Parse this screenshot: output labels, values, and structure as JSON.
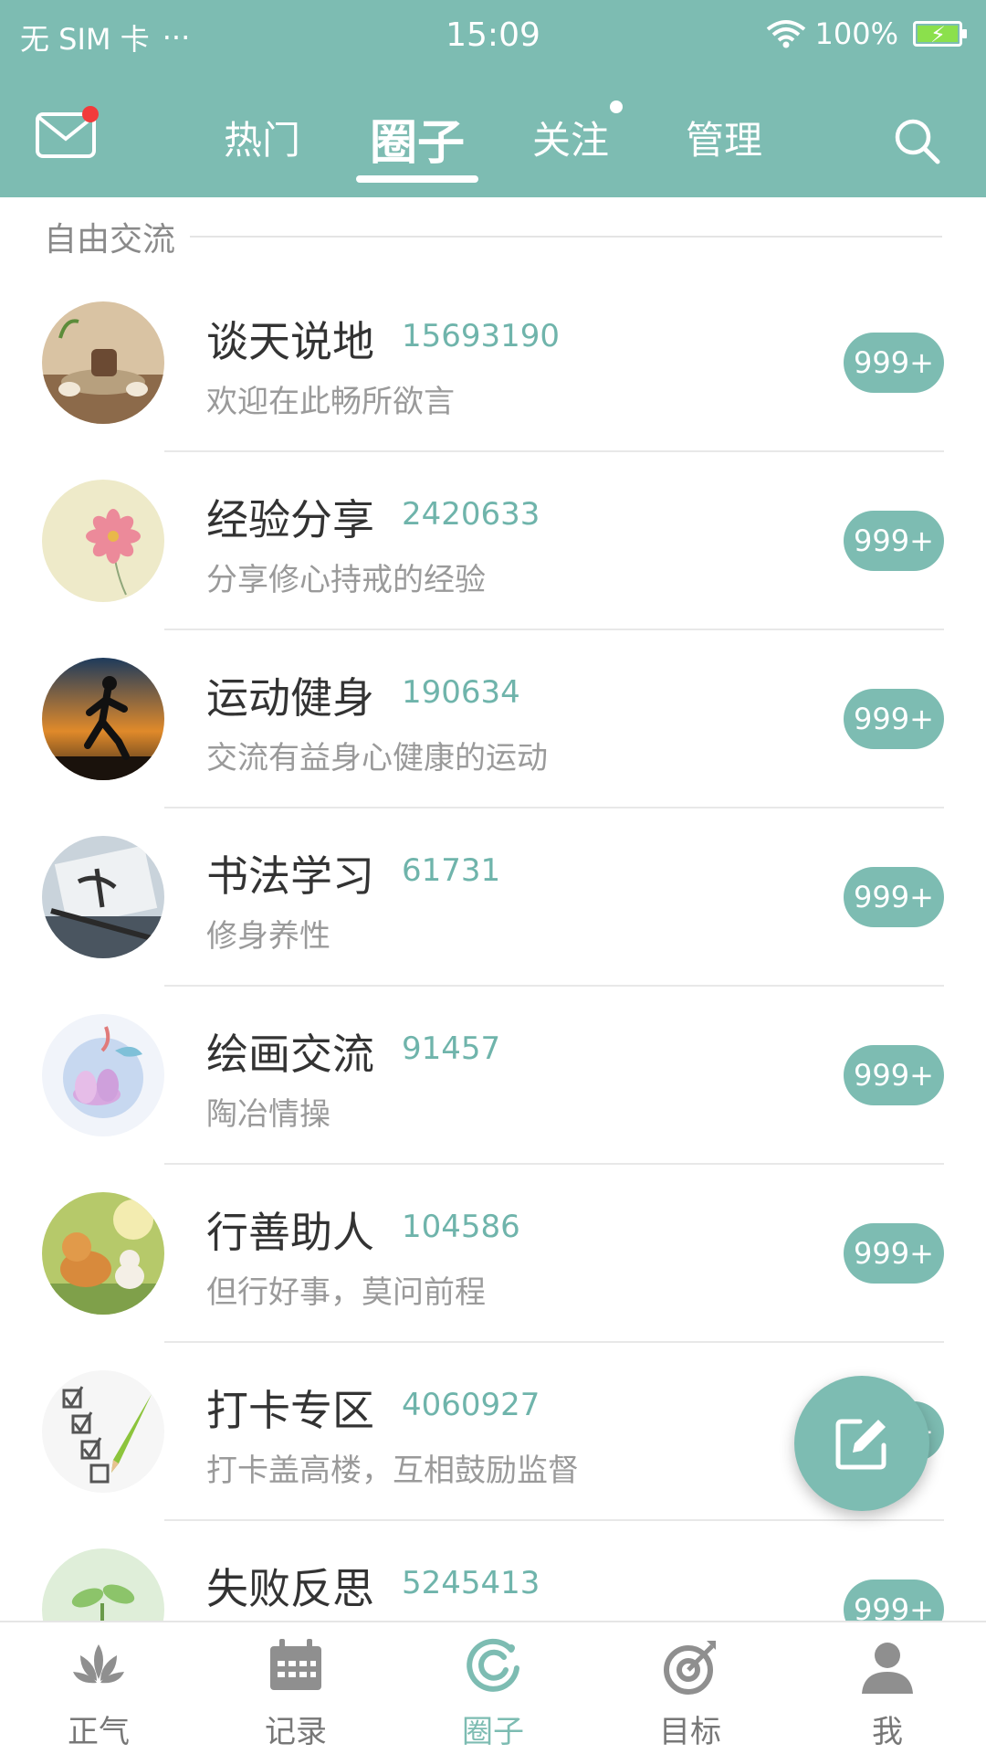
{
  "status_bar": {
    "carrier": "无 SIM 卡",
    "dots": "···",
    "time": "15:09",
    "battery": "100%"
  },
  "header": {
    "tabs": [
      {
        "label": "热门"
      },
      {
        "label": "圈子"
      },
      {
        "label": "关注"
      },
      {
        "label": "管理"
      }
    ],
    "active_tab": "圈子"
  },
  "section": {
    "title": "自由交流"
  },
  "circles": [
    {
      "name": "谈天说地",
      "count": "15693190",
      "desc": "欢迎在此畅所欲言",
      "badge": "999+"
    },
    {
      "name": "经验分享",
      "count": "2420633",
      "desc": "分享修心持戒的经验",
      "badge": "999+"
    },
    {
      "name": "运动健身",
      "count": "190634",
      "desc": "交流有益身心健康的运动",
      "badge": "999+"
    },
    {
      "name": "书法学习",
      "count": "61731",
      "desc": "修身养性",
      "badge": "999+"
    },
    {
      "name": "绘画交流",
      "count": "91457",
      "desc": "陶冶情操",
      "badge": "999+"
    },
    {
      "name": "行善助人",
      "count": "104586",
      "desc": "但行好事，莫问前程",
      "badge": "999+"
    },
    {
      "name": "打卡专区",
      "count": "4060927",
      "desc": "打卡盖高楼，互相鼓励监督",
      "badge": "999+"
    },
    {
      "name": "失败反思",
      "count": "5245413",
      "desc": "",
      "badge": "999+"
    }
  ],
  "bottom_nav": [
    {
      "label": "正气",
      "icon": "lotus-icon"
    },
    {
      "label": "记录",
      "icon": "calendar-icon"
    },
    {
      "label": "圈子",
      "icon": "circle-icon"
    },
    {
      "label": "目标",
      "icon": "target-icon"
    },
    {
      "label": "我",
      "icon": "person-icon"
    }
  ],
  "colors": {
    "accent": "#7dbcb2",
    "count": "#6fb4ab",
    "notification": "#f23b3b"
  }
}
